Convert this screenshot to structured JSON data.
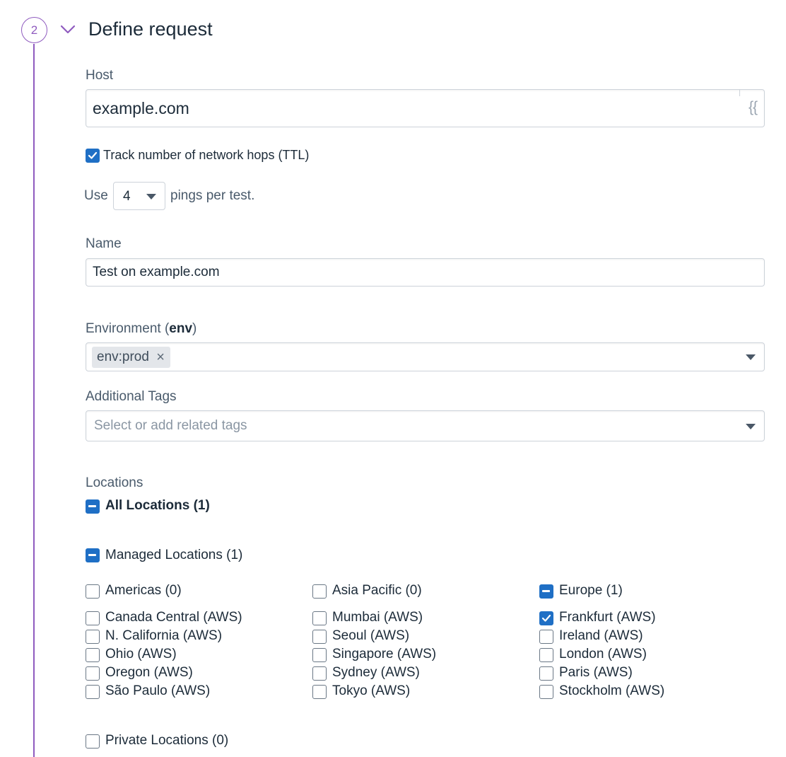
{
  "step": {
    "number": "2",
    "title": "Define request"
  },
  "host": {
    "label": "Host",
    "value": "example.com",
    "variable_hint": "{{"
  },
  "ttl": {
    "label": "Track number of network hops (TTL)",
    "checked": true
  },
  "pings": {
    "prefix": "Use",
    "value": "4",
    "suffix": "pings per test."
  },
  "name": {
    "label": "Name",
    "value": "Test on example.com"
  },
  "environment": {
    "label_prefix": "Environment (",
    "label_key": "env",
    "label_suffix": ")",
    "tag": "env:prod",
    "remove_glyph": "×"
  },
  "additional_tags": {
    "label": "Additional Tags",
    "placeholder": "Select or add related tags"
  },
  "locations": {
    "label": "Locations",
    "all": "All Locations (1)",
    "managed": "Managed Locations (1)",
    "regions": [
      {
        "name": "Americas (0)",
        "state": "unchecked",
        "items": [
          {
            "label": "Canada Central (AWS)",
            "checked": false
          },
          {
            "label": "N. California (AWS)",
            "checked": false
          },
          {
            "label": "Ohio (AWS)",
            "checked": false
          },
          {
            "label": "Oregon (AWS)",
            "checked": false
          },
          {
            "label": "São Paulo (AWS)",
            "checked": false
          }
        ]
      },
      {
        "name": "Asia Pacific (0)",
        "state": "unchecked",
        "items": [
          {
            "label": "Mumbai (AWS)",
            "checked": false
          },
          {
            "label": "Seoul (AWS)",
            "checked": false
          },
          {
            "label": "Singapore (AWS)",
            "checked": false
          },
          {
            "label": "Sydney (AWS)",
            "checked": false
          },
          {
            "label": "Tokyo (AWS)",
            "checked": false
          }
        ]
      },
      {
        "name": "Europe (1)",
        "state": "indeterminate",
        "items": [
          {
            "label": "Frankfurt (AWS)",
            "checked": true
          },
          {
            "label": "Ireland (AWS)",
            "checked": false
          },
          {
            "label": "London (AWS)",
            "checked": false
          },
          {
            "label": "Paris (AWS)",
            "checked": false
          },
          {
            "label": "Stockholm (AWS)",
            "checked": false
          }
        ]
      }
    ],
    "private": "Private Locations (0)"
  },
  "colors": {
    "accent": "#8f5bbf",
    "checkbox": "#1f6fc5",
    "text": "#1c2b39"
  }
}
